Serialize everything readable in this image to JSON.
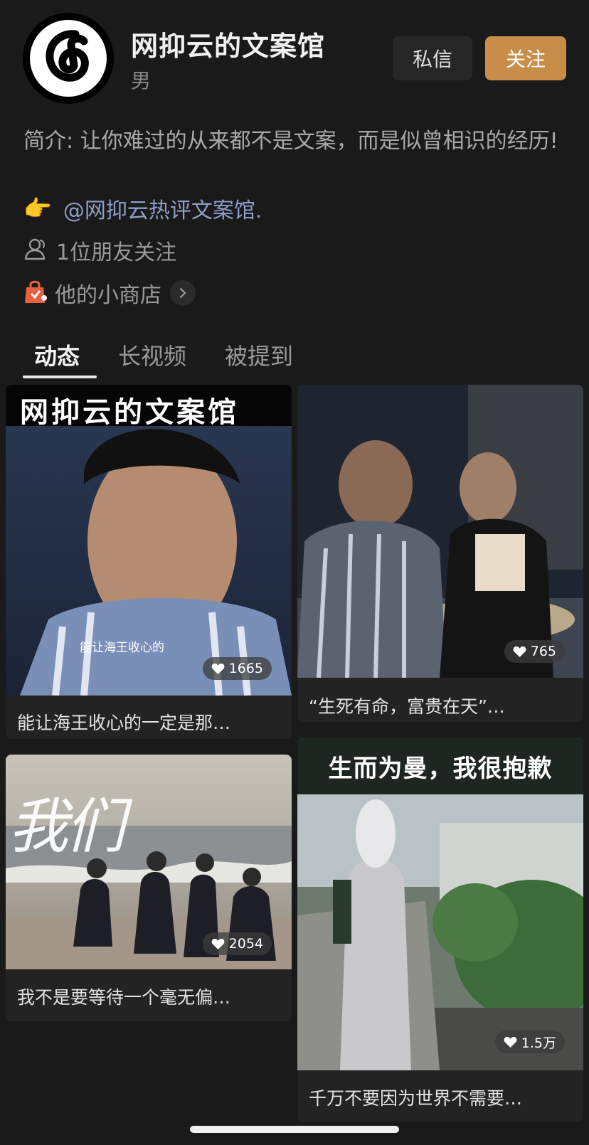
{
  "profile": {
    "name": "网抑云的文案馆",
    "gender": "男",
    "bio": "简介: 让你难过的从来都不是文案，而是似曾相识的经历!",
    "mention_icon": "👉",
    "mention": "@网抑云热评文案馆.",
    "friends": "1位朋友关注",
    "shop": "他的小商店"
  },
  "actions": {
    "message": "私信",
    "follow": "关注"
  },
  "tabs": [
    "动态",
    "长视频",
    "被提到"
  ],
  "active_tab": "动态",
  "posts": [
    {
      "overlay_title": "网抑云的文案馆",
      "subtitle": "能让海王收心的",
      "likes": "1665",
      "caption": "能让海王收心的一定是那…"
    },
    {
      "likes": "765",
      "caption": "“生死有命，富贵在天”…"
    },
    {
      "overlay_title": "我们",
      "likes": "2054",
      "caption": "我不是要等待一个毫无偏…"
    },
    {
      "overlay_title": "生而为曼，我很抱歉",
      "likes": "1.5万",
      "caption": "千万不要因为世界不需要…"
    }
  ],
  "colors": {
    "background": "#1a1a1a",
    "follow_button": "#c88d48",
    "mention_link": "#8c9fc9",
    "shop_icon": "#e8613c"
  },
  "icons": {
    "avatar_logo": "netease-music-logo",
    "friends": "person-outline-icon",
    "shop": "shopping-bag-icon",
    "chevron": "chevron-right-icon",
    "likes": "heart-icon"
  }
}
